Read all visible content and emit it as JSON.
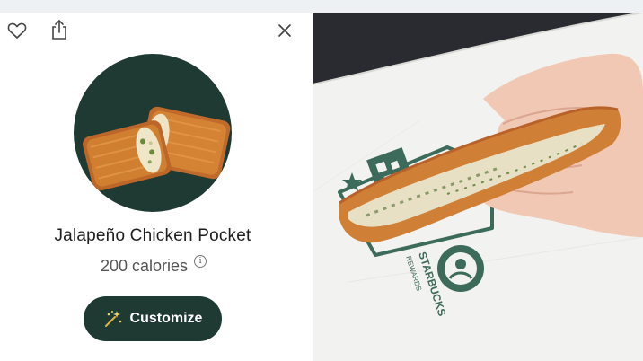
{
  "product": {
    "name": "Jalapeño Chicken Pocket",
    "calories": "200 calories",
    "info_symbol": "i",
    "image_icon": "jalapeno-chicken-pocket-image"
  },
  "actions": {
    "customize_label": "Customize",
    "customize_icon": "magic-wand-icon",
    "favorite_icon": "heart-icon",
    "share_icon": "share-icon",
    "close_icon": "close-icon"
  },
  "photo": {
    "wrapper_text": "STARBUCKS",
    "wrapper_subtext": "REWARDS",
    "description": "Hand holding bitten pocket sandwich over Starbucks rewards paper bag"
  },
  "colors": {
    "brand_green": "#1f3933",
    "text_dark": "#1e1e1e",
    "text_muted": "#555555",
    "wrapper_green": "#3c6a5b"
  }
}
